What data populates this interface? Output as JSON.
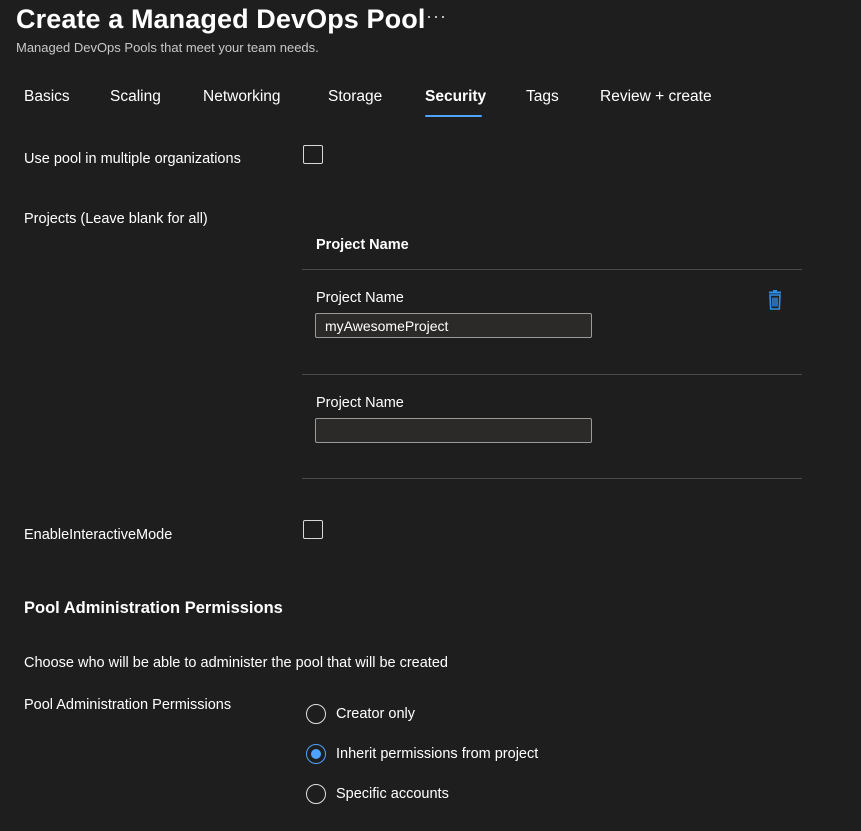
{
  "header": {
    "title": "Create a Managed DevOps Pool",
    "more_label": "···",
    "subtitle": "Managed DevOps Pools that meet your team needs."
  },
  "tabs": [
    {
      "label": "Basics",
      "active": false
    },
    {
      "label": "Scaling",
      "active": false
    },
    {
      "label": "Networking",
      "active": false
    },
    {
      "label": "Storage",
      "active": false
    },
    {
      "label": "Security",
      "active": true
    },
    {
      "label": "Tags",
      "active": false
    },
    {
      "label": "Review + create",
      "active": false
    }
  ],
  "form": {
    "multi_org_label": "Use pool in multiple organizations",
    "multi_org_checked": false,
    "projects_label": "Projects (Leave blank for all)",
    "projects_table": {
      "column_header": "Project Name",
      "rows": [
        {
          "field_label": "Project Name",
          "value": "myAwesomeProject",
          "has_delete": true,
          "delete_icon": "trash-icon"
        },
        {
          "field_label": "Project Name",
          "value": "",
          "has_delete": false
        }
      ]
    },
    "interactive_mode_label": "EnableInteractiveMode",
    "interactive_mode_checked": false
  },
  "permissions": {
    "section_title": "Pool Administration Permissions",
    "description": "Choose who will be able to administer the pool that will be created",
    "field_label": "Pool Administration Permissions",
    "options": [
      {
        "label": "Creator only",
        "selected": false
      },
      {
        "label": "Inherit permissions from project",
        "selected": true
      },
      {
        "label": "Specific accounts",
        "selected": false
      }
    ]
  },
  "colors": {
    "background": "#1f1e1e",
    "accent": "#4da3ff",
    "text": "#ffffff",
    "divider": "#4a4a4a"
  }
}
